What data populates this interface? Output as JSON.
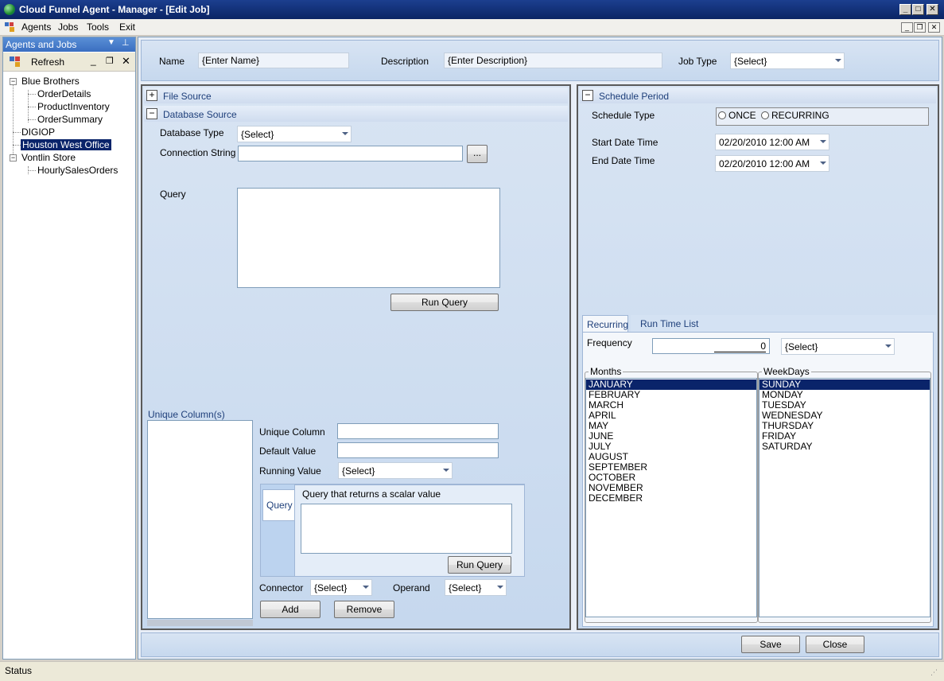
{
  "window": {
    "title": "Cloud Funnel Agent - Manager - [Edit Job]"
  },
  "menu": [
    "Agents",
    "Jobs",
    "Tools",
    "Exit"
  ],
  "dock": {
    "title": "Agents and Jobs",
    "refresh_label": "Refresh"
  },
  "tree": {
    "blue_brothers": "Blue Brothers",
    "order_details": "OrderDetails",
    "product_inventory": "ProductInventory",
    "order_summary": "OrderSummary",
    "digiop": "DIGIOP",
    "houston": "Houston West Office",
    "vontlin": "Vontlin Store",
    "hourly": "HourlySalesOrders"
  },
  "job": {
    "name_label": "Name",
    "name_value": "{Enter Name}",
    "description_label": "Description",
    "description_value": "{Enter Description}",
    "jobtype_label": "Job Type",
    "jobtype_value": "{Select}"
  },
  "source": {
    "file_source": "File Source",
    "database_source": "Database Source",
    "database_type_label": "Database Type",
    "database_type_value": "{Select}",
    "connection_string_label": "Connection String",
    "browse_label": "...",
    "query_label": "Query",
    "run_query_label": "Run Query"
  },
  "unique": {
    "section_label": "Unique Column(s)",
    "unique_column_label": "Unique Column",
    "default_value_label": "Default Value",
    "running_value_label": "Running Value",
    "running_value_value": "{Select}",
    "query_tab": "Query",
    "scalar_label": "Query that returns a scalar value",
    "run_query_label": "Run Query",
    "connector_label": "Connector",
    "connector_value": "{Select}",
    "operand_label": "Operand",
    "operand_value": "{Select}",
    "add_label": "Add",
    "remove_label": "Remove"
  },
  "schedule": {
    "section_label": "Schedule Period",
    "schedule_type_label": "Schedule Type",
    "once_label": "ONCE",
    "recurring_label": "RECURRING",
    "start_label": "Start Date Time",
    "start_value": "02/20/2010 12:00 AM",
    "end_label": "End Date Time",
    "end_value": "02/20/2010 12:00 AM",
    "tab_recurring": "Recurring",
    "tab_runtime": "Run Time List",
    "frequency_label": "Frequency",
    "frequency_value": "0",
    "frequency_unit": "{Select}",
    "months_label": "Months",
    "months": [
      "JANUARY",
      "FEBRUARY",
      "MARCH",
      "APRIL",
      "MAY",
      "JUNE",
      "JULY",
      "AUGUST",
      "SEPTEMBER",
      "OCTOBER",
      "NOVEMBER",
      "DECEMBER"
    ],
    "weekdays_label": "WeekDays",
    "weekdays": [
      "SUNDAY",
      "MONDAY",
      "TUESDAY",
      "WEDNESDAY",
      "THURSDAY",
      "FRIDAY",
      "SATURDAY"
    ]
  },
  "footer": {
    "save_label": "Save",
    "close_label": "Close"
  },
  "status": "Status",
  "colors": {
    "selection": "#0a246a",
    "title_bar": "#0a2464",
    "panel": "#c6d8ee"
  }
}
